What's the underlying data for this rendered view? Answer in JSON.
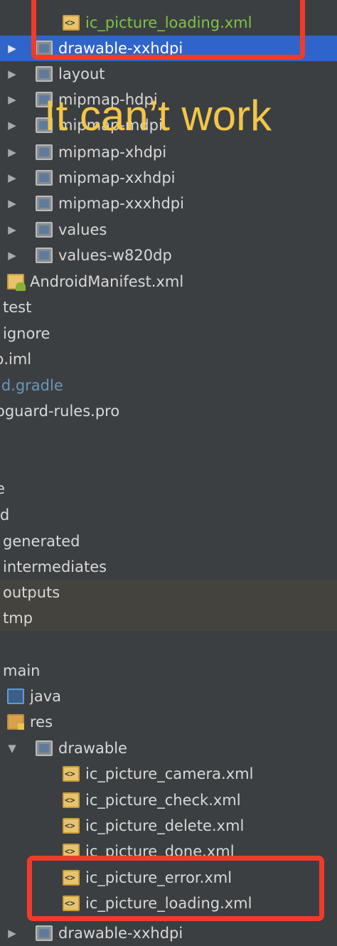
{
  "overlay_text": "It can’t work",
  "tree": {
    "top_file": "ic_picture_loading.xml",
    "drawable_xxhdpi": "drawable-xxhdpi",
    "layout": "layout",
    "mipmap_hdpi": "mipmap-hdpi",
    "mipmap_mdpi": "mipmap-mdpi",
    "mipmap_xhdpi": "mipmap-xhdpi",
    "mipmap_xxhdpi": "mipmap-xxhdpi",
    "mipmap_xxxhdpi": "mipmap-xxxhdpi",
    "values": "values",
    "values_w820dp": "values-w820dp",
    "manifest": "AndroidManifest.xml",
    "test": "test",
    "gitignore": "ignore",
    "iml": "p.iml",
    "build_gradle": "ld.gradle",
    "proguard": "oguard-rules.pro",
    "e": "e",
    "ld": "ld",
    "generated": "generated",
    "intermediates": "intermediates",
    "outputs": "outputs",
    "tmp": "tmp",
    "main": "main",
    "java": "java",
    "res": "res",
    "drawable": "drawable",
    "camera": "ic_picture_camera.xml",
    "check": "ic_picture_check.xml",
    "delete": "ic_picture_delete.xml",
    "done": "ic_picture_done.xml",
    "error": "ic_picture_error.xml",
    "loading": "ic_picture_loading.xml",
    "cut_bottom": "drawable-xxhdpi"
  },
  "colors": {
    "background": "#3c3f41",
    "selection": "#2f65ca",
    "highlight_box": "#f13b2a",
    "overlay_text": "#f2c64a"
  }
}
